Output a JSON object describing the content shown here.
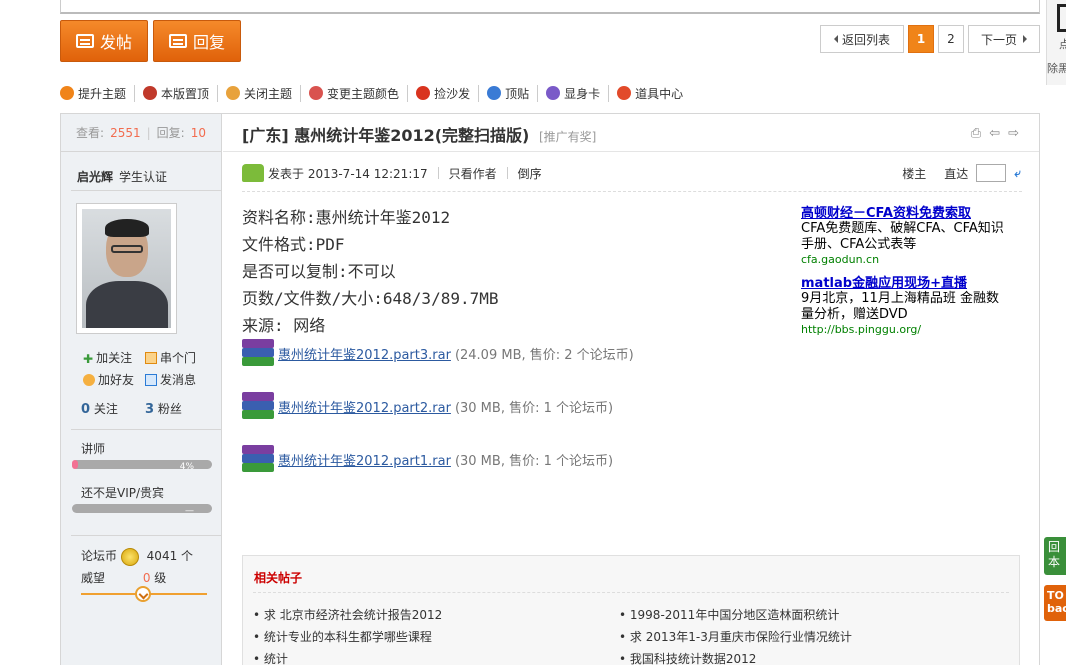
{
  "buttons": {
    "post": "发帖",
    "reply": "回复"
  },
  "pager": {
    "back": "返回列表",
    "page1": "1",
    "page2": "2",
    "next": "下一页"
  },
  "side": {
    "qr_text1": "点",
    "qr_text2": "除黑",
    "reply_float": "回 本",
    "top_float": "TO bac"
  },
  "toolbar": [
    {
      "label": "提升主题",
      "icon": "raise-icon",
      "color": "#f08419"
    },
    {
      "label": "本版置顶",
      "icon": "pin-icon",
      "color": "#c0392b"
    },
    {
      "label": "关闭主题",
      "icon": "face-icon",
      "color": "#e8a23c"
    },
    {
      "label": "变更主题颜色",
      "icon": "paint-icon",
      "color": "#d9534f"
    },
    {
      "label": "捡沙发",
      "icon": "sofa-icon",
      "color": "#d9341f"
    },
    {
      "label": "顶贴",
      "icon": "up-arrow-icon",
      "color": "#3a7bd5"
    },
    {
      "label": "显身卡",
      "icon": "reveal-card-icon",
      "color": "#7a5ac8"
    },
    {
      "label": "道具中心",
      "icon": "tool-center-icon",
      "color": "#e24a2a"
    }
  ],
  "user": {
    "views_label": "查看:",
    "views": "2551",
    "replies_label": "回复:",
    "replies": "10",
    "name": "启光辉",
    "cert": "学生认证",
    "actions": {
      "follow": "加关注",
      "visit": "串个门",
      "friend": "加好友",
      "message": "发消息"
    },
    "following_count": "0",
    "following_label": "关注",
    "fans_count": "3",
    "fans_label": "粉丝",
    "rank": "讲师",
    "rank_progress_text": "4%",
    "rank_progress": 0.04,
    "vip": "还不是VIP/贵宾",
    "vip_text": "—",
    "coins_label": "论坛币",
    "coins": "4041 个",
    "reputation_label": "威望",
    "reputation_num": "0",
    "reputation_unit": " 级"
  },
  "post": {
    "title": "[广东] 惠州统计年鉴2012(完整扫描版)",
    "title_tag": "[推广有奖]",
    "date": "发表于 2013-7-14 12:21:17",
    "only_author": "只看作者",
    "reverse": "倒序",
    "floor": "楼主",
    "goto": "直达",
    "content": [
      "资料名称:惠州统计年鉴2012",
      "文件格式:PDF",
      "是否可以复制:不可以",
      "页数/文件数/大小:648/3/89.7MB",
      "来源: 网络"
    ],
    "attachments": [
      {
        "name": "惠州统计年鉴2012.part3.rar",
        "info": "(24.09 MB, 售价: 2 个论坛币)"
      },
      {
        "name": "惠州统计年鉴2012.part2.rar",
        "info": "(30 MB, 售价: 1 个论坛币)"
      },
      {
        "name": "惠州统计年鉴2012.part1.rar",
        "info": "(30 MB, 售价: 1 个论坛币)"
      }
    ]
  },
  "ads": [
    {
      "title": "高顿财经－CFA资料免费索取",
      "desc": "CFA免费题库、破解CFA、CFA知识手册、CFA公式表等",
      "url": "cfa.gaodun.cn"
    },
    {
      "title": "matlab金融应用现场+直播",
      "desc": "9月北京，11月上海精品班 金融数量分析，赠送DVD",
      "url": "http://bbs.pinggu.org/"
    }
  ],
  "related": {
    "title": "相关帖子",
    "items": [
      "求 北京市经济社会统计报告2012",
      "1998-2011年中国分地区造林面积统计",
      "统计专业的本科生都学哪些课程",
      "求 2013年1-3月重庆市保险行业情况统计",
      "统计",
      "我国科技统计数据2012"
    ]
  }
}
